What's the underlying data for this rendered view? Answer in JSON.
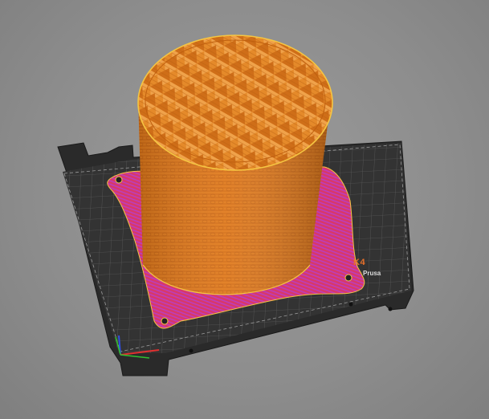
{
  "viewport": {
    "background": "#8e8e8e"
  },
  "bed": {
    "model_label": "K4",
    "maker_label": "Prusa",
    "plate_color": "#2a2a2a",
    "grid_color": "#5a5a5a",
    "logo_color": "#e8702a"
  },
  "object": {
    "body_color": "#e07a1c",
    "top_edge_color": "#f5c542",
    "brim_color": "#d8386a",
    "brim_accent": "#c14bd0"
  },
  "axes": {
    "x_color": "#e03030",
    "y_color": "#30c030",
    "z_color": "#3050e0"
  }
}
